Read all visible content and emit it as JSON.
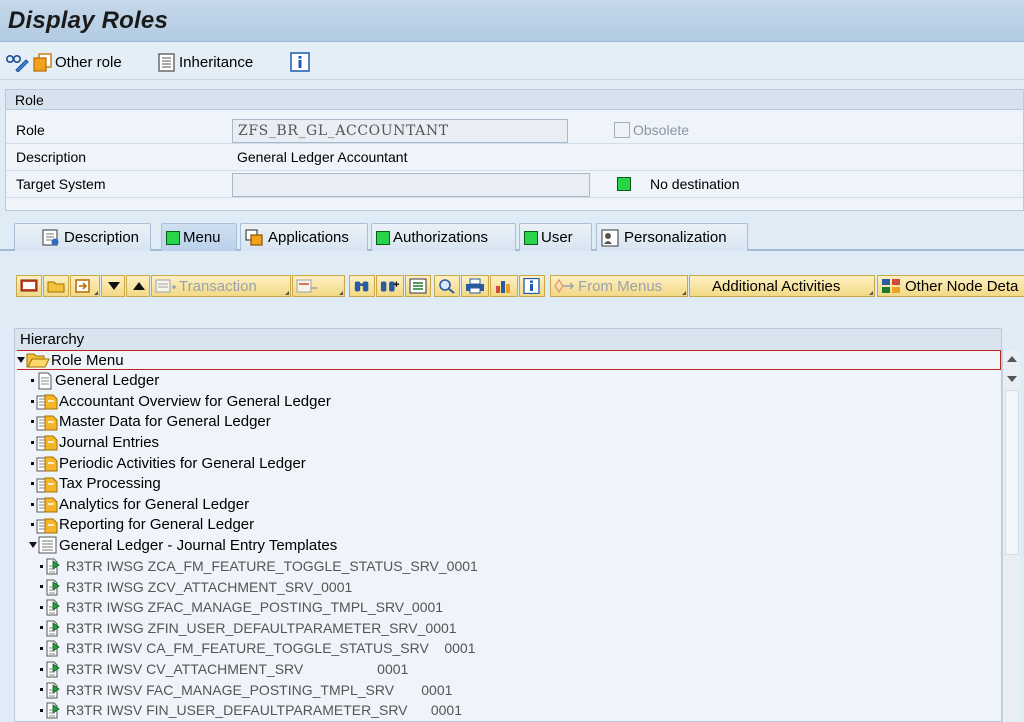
{
  "title": "Display Roles",
  "toolbar": {
    "other_role": "Other role",
    "inheritance": "Inheritance",
    "info_icon": "info-icon"
  },
  "role_panel": {
    "heading": "Role",
    "role_label": "Role",
    "role_value": "ZFS_BR_GL_ACCOUNTANT",
    "obsolete_label": "Obsolete",
    "description_label": "Description",
    "description_value": "General Ledger Accountant",
    "target_label": "Target System",
    "target_value": "",
    "destination_status": "No destination",
    "status_color": "#29d34a"
  },
  "tabs": [
    {
      "label": "Description"
    },
    {
      "label": "Menu"
    },
    {
      "label": "Applications"
    },
    {
      "label": "Authorizations"
    },
    {
      "label": "User"
    },
    {
      "label": "Personalization"
    }
  ],
  "menu_toolbar": {
    "transaction": "Transaction",
    "from_menus": "From Menus",
    "additional_activities": "Additional Activities",
    "other_node_details": "Other Node Deta"
  },
  "tree": {
    "header": "Hierarchy",
    "items": [
      {
        "label": "Role Menu",
        "icon": "folder-open-icon",
        "level": 0
      },
      {
        "label": "General Ledger",
        "icon": "document-icon",
        "level": 1
      },
      {
        "label": "Accountant Overview for General Ledger",
        "icon": "folder-link-icon",
        "level": 1
      },
      {
        "label": "Master Data for General Ledger",
        "icon": "folder-link-icon",
        "level": 1
      },
      {
        "label": "Journal Entries",
        "icon": "folder-link-icon",
        "level": 1
      },
      {
        "label": "Periodic Activities for General Ledger",
        "icon": "folder-link-icon",
        "level": 1
      },
      {
        "label": "Tax Processing",
        "icon": "folder-link-icon",
        "level": 1
      },
      {
        "label": "Analytics for General Ledger",
        "icon": "folder-link-icon",
        "level": 1
      },
      {
        "label": "Reporting for General Ledger",
        "icon": "folder-link-icon",
        "level": 1
      },
      {
        "label": "General Ledger - Journal Entry Templates",
        "icon": "document-list-icon",
        "level": 1
      },
      {
        "label": "R3TR IWSG ZCA_FM_FEATURE_TOGGLE_STATUS_SRV_0001",
        "icon": "service-icon",
        "level": 2
      },
      {
        "label": "R3TR IWSG ZCV_ATTACHMENT_SRV_0001",
        "icon": "service-icon",
        "level": 2
      },
      {
        "label": "R3TR IWSG ZFAC_MANAGE_POSTING_TMPL_SRV_0001",
        "icon": "service-icon",
        "level": 2
      },
      {
        "label": "R3TR IWSG ZFIN_USER_DEFAULTPARAMETER_SRV_0001",
        "icon": "service-icon",
        "level": 2
      },
      {
        "label": "R3TR IWSV CA_FM_FEATURE_TOGGLE_STATUS_SRV    0001",
        "icon": "service-icon",
        "level": 2
      },
      {
        "label": "R3TR IWSV CV_ATTACHMENT_SRV                   0001",
        "icon": "service-icon",
        "level": 2
      },
      {
        "label": "R3TR IWSV FAC_MANAGE_POSTING_TMPL_SRV       0001",
        "icon": "service-icon",
        "level": 2
      },
      {
        "label": "R3TR IWSV FIN_USER_DEFAULTPARAMETER_SRV      0001",
        "icon": "service-icon",
        "level": 2
      }
    ]
  }
}
